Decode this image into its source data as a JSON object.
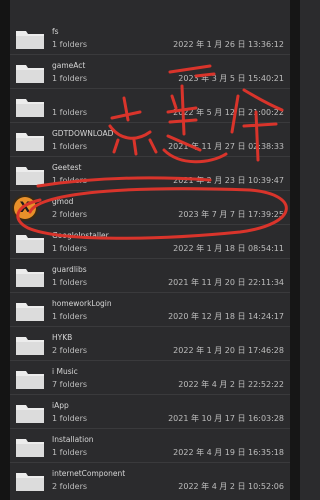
{
  "rows": [
    {
      "name": "fs",
      "count": "1 folders",
      "date": "2022 年 1 月 26 日 13:36:12"
    },
    {
      "name": "gameAct",
      "count": "1 folders",
      "date": "2023 年 3 月 5 日 15:40:21"
    },
    {
      "name": "",
      "count": "1 folders",
      "date": "2022 年 5 月 12 日 21:00:22"
    },
    {
      "name": "GDTDOWNLOAD",
      "count": "1 folders",
      "date": "2021 年 11 月 27 日 02:38:33"
    },
    {
      "name": "Geetest",
      "count": "1 folders",
      "date": "2021 年 2 月 23 日 10:39:47"
    },
    {
      "name": "gmod",
      "count": "2 folders",
      "date": "2023 年 7 月 7 日 17:39:25"
    },
    {
      "name": "GoogleInstaller",
      "count": "1 folders",
      "date": "2022 年 1 月 18 日 08:54:11"
    },
    {
      "name": "guardlibs",
      "count": "1 folders",
      "date": "2021 年 11 月 20 日 22:11:34"
    },
    {
      "name": "homeworkLogin",
      "count": "1 folders",
      "date": "2020 年 12 月 18 日 14:24:17"
    },
    {
      "name": "HYKB",
      "count": "2 folders",
      "date": "2022 年 1 月 20 日 17:46:28"
    },
    {
      "name": "i Music",
      "count": "7 folders",
      "date": "2022 年 4 月 2 日 22:52:22"
    },
    {
      "name": "iApp",
      "count": "1 folders",
      "date": "2021 年 10 月 17 日 16:03:28"
    },
    {
      "name": "Installation",
      "count": "1 folders",
      "date": "2022 年 4 月 19 日 16:35:18"
    },
    {
      "name": "internetComponent",
      "count": "2 folders",
      "date": "2022 年 4 月 2 日 10:52:06"
    }
  ],
  "selected_badge": "X",
  "colors": {
    "background": "#2b2b2d",
    "folder": "#ececec",
    "annotation": "#d9342b",
    "badge": "#e8902a"
  }
}
